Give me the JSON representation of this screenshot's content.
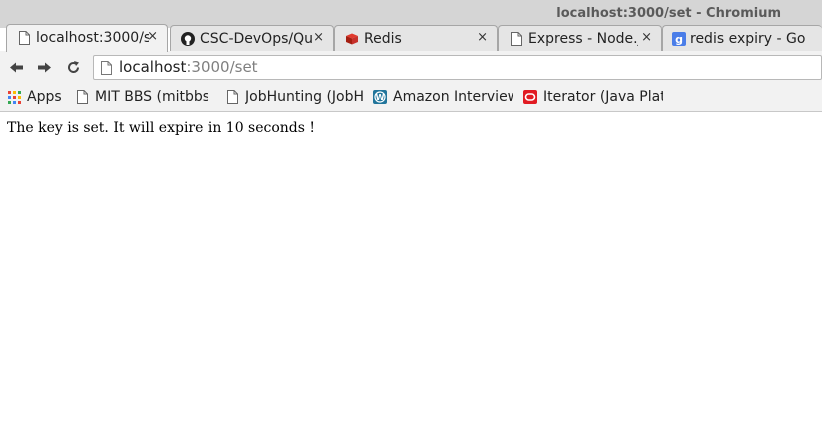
{
  "window": {
    "title": "localhost:3000/set - Chromium"
  },
  "tabs": [
    {
      "label": "localhost:3000/s",
      "icon": "page-icon",
      "active": true
    },
    {
      "label": "CSC-DevOps/Qu",
      "icon": "github-icon"
    },
    {
      "label": "Redis",
      "icon": "redis-icon"
    },
    {
      "label": "Express - Node.j",
      "icon": "page-icon"
    },
    {
      "label": "redis expiry - Go",
      "icon": "google-icon"
    }
  ],
  "tab_close_glyph": "×",
  "omnibox": {
    "host": "localhost",
    "path": ":3000/set"
  },
  "bookmarks": [
    {
      "label": "Apps",
      "icon": "apps-grid-icon"
    },
    {
      "label": "MIT BBS (mitbbs.c",
      "icon": "page-icon"
    },
    {
      "label": "JobHunting (JobHu",
      "icon": "page-icon"
    },
    {
      "label": "Amazon Interview",
      "icon": "wordpress-icon"
    },
    {
      "label": "Iterator (Java Platf",
      "icon": "oracle-icon"
    }
  ],
  "page": {
    "text": "The key is set. It will expire in 10 seconds !"
  }
}
